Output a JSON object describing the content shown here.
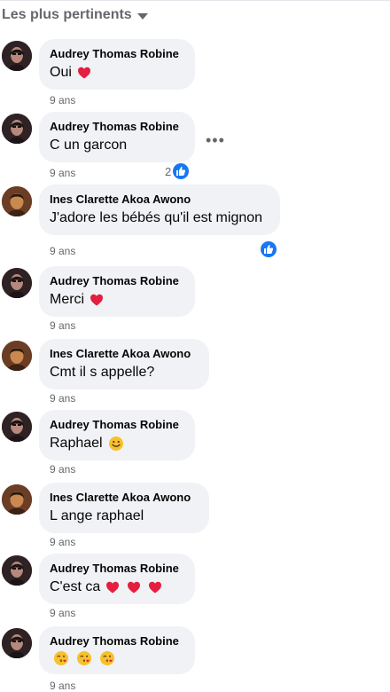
{
  "sort_label": "Les plus pertinents",
  "comments": [
    {
      "author": "Audrey Thomas Robine",
      "text": "Oui",
      "emoji": "heart",
      "emoji_count": 1,
      "time": "9 ans",
      "avatar": "audrey"
    },
    {
      "author": "Audrey Thomas Robine",
      "text": "C un garcon",
      "time": "9 ans",
      "avatar": "audrey",
      "likes": "2",
      "show_more": "•••"
    },
    {
      "author": "Ines Clarette Akoa Awono",
      "text": "J'adore les bébés qu'il est mignon",
      "time": "9 ans",
      "avatar": "ines"
    },
    {
      "author": "Audrey Thomas Robine",
      "text": "Merci",
      "emoji": "heart",
      "emoji_count": 1,
      "time": "9 ans",
      "avatar": "audrey"
    },
    {
      "author": "Ines Clarette Akoa Awono",
      "text": "Cmt il s appelle?",
      "time": "9 ans",
      "avatar": "ines"
    },
    {
      "author": "Audrey Thomas Robine",
      "text": "Raphael",
      "emoji": "smile",
      "emoji_count": 1,
      "time": "9 ans",
      "avatar": "audrey"
    },
    {
      "author": "Ines Clarette Akoa Awono",
      "text": "L ange raphael",
      "time": "9 ans",
      "avatar": "ines"
    },
    {
      "author": "Audrey Thomas Robine",
      "text": "C'est ca",
      "emoji": "heart",
      "emoji_count": 3,
      "time": "9 ans",
      "avatar": "audrey"
    },
    {
      "author": "Audrey Thomas Robine",
      "text": "",
      "emoji": "kiss",
      "emoji_count": 3,
      "time": "9 ans",
      "avatar": "audrey"
    }
  ],
  "colors": {
    "bubble": "#f0f2f5",
    "like_blue": "#1877f2",
    "heart_red": "#e41e3f",
    "meta_gray": "#65676b"
  }
}
